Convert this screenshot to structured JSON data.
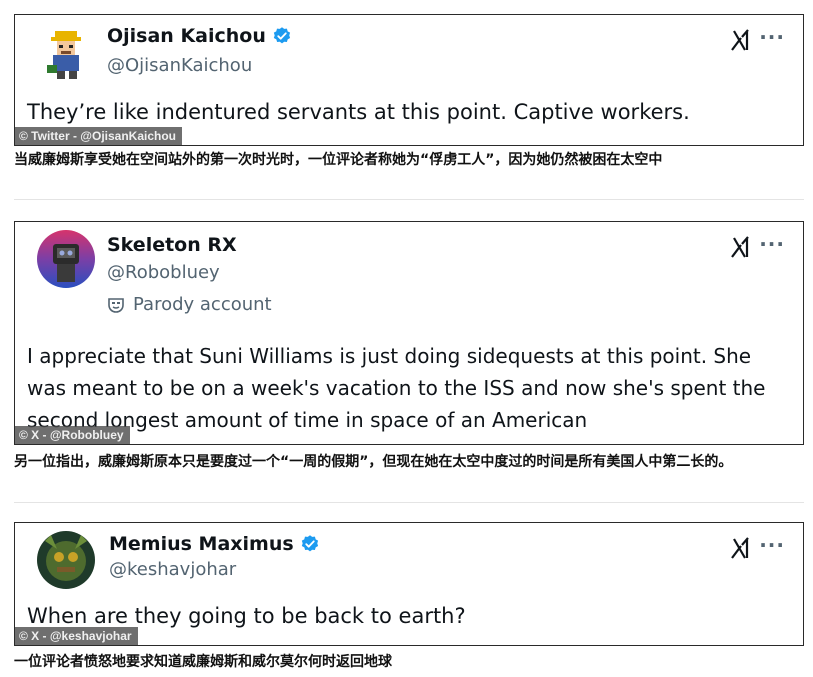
{
  "tweets": [
    {
      "display_name": "Ojisan Kaichou",
      "handle": "@OjisanKaichou",
      "verified": true,
      "text": "They’re like indentured servants at this point. Captive workers.",
      "credit": "© Twitter - @OjisanKaichou",
      "caption": "当威廉姆斯享受她在空间站外的第一次时光时，一位评论者称她为“俘虏工人”，因为她仍然被困在太空中"
    },
    {
      "display_name": "Skeleton RX",
      "handle": "@Robobluey",
      "verified": false,
      "badge": "Parody account",
      "text": "I appreciate that Suni Williams is just doing sidequests at this point. She was meant to be on a week's vacation to the ISS and now she's spent the second longest amount of time in space of an American",
      "credit": "© X - @Robobluey",
      "caption": "另一位指出，威廉姆斯原本只是要度过一个“一周的假期”，但现在她在太空中度过的时间是所有美国人中第二长的。"
    },
    {
      "display_name": "Memius Maximus",
      "handle": "@keshavjohar",
      "verified": true,
      "text": "When are they going to be back to earth?",
      "credit": "© X - @keshavjohar",
      "caption": "一位评论者愤怒地要求知道威廉姆斯和威尔莫尔何时返回地球"
    }
  ],
  "icons": {
    "verified": "verified-badge-icon",
    "x_logo": "x-logo-icon",
    "more": "more-options-icon",
    "parody": "parody-mask-icon"
  },
  "more_glyph": "···",
  "colors": {
    "verified_blue": "#1d9bf0",
    "handle_gray": "#536471",
    "text": "#0f1419"
  }
}
